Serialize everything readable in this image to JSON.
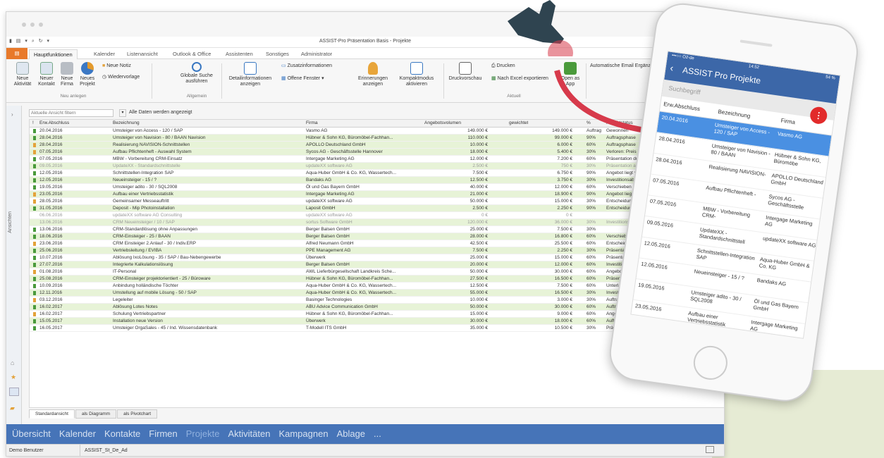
{
  "window": {
    "title": "ASSIST-Pro Präsentation Basis - Projekte"
  },
  "ribbon_tabs": [
    "Hauptfunktionen",
    "Kalender",
    "Listenansicht",
    "Outlook & Office",
    "Assistenten",
    "Sonstiges",
    "Administrator"
  ],
  "ribbon": {
    "neue_aktivitaet": "Neue Aktivität",
    "neuer_kontakt": "Neuer Kontakt",
    "neue_firma": "Neue Firma",
    "neues_projekt": "Neues Projekt",
    "neue_notiz": "Neue Notiz",
    "wiedervorlage": "Wiedervorlage",
    "group_neu": "Neu anlegen",
    "globale_suche": "Globale Suche ausführen",
    "group_allgemein": "Allgemein",
    "detailinfo": "Detailinformationen anzeigen",
    "zusatzinfo": "Zusatzinformationen",
    "offene_fenster": "Offene Fenster",
    "erinnerungen": "Erinnerungen anzeigen",
    "kompaktmodus": "Kompaktmodus aktivieren",
    "druckvorschau": "Druckvorschau",
    "drucken": "Drucken",
    "excel": "Nach Excel exportieren",
    "group_aktuell": "Aktuell",
    "open_app": "Open as App",
    "auto_email": "Automatische Email Ergänzung"
  },
  "left_sidebar_label": "Ansichten",
  "filter": {
    "placeholder": "Aktuelle Ansicht filtern",
    "status": "Alle Daten werden angezeigt"
  },
  "columns": [
    "!",
    "Erw.Abschluss",
    "Bezeichnung",
    "Firma",
    "Angebotsvolumen",
    "gewichtet",
    "%",
    "Projektstatus"
  ],
  "rows": [
    {
      "date": "20.04.2016",
      "bez": "Umsteiger von Access - 120 / SAP",
      "firma": "Vasmo AG",
      "vol": "149.000 €",
      "gew": "149.000 €",
      "pct": "Auftrag",
      "status": "Gewonnen",
      "flag": "#4a9a3b",
      "style": ""
    },
    {
      "date": "28.04.2016",
      "bez": "Umsteiger von Navision - 80 / BAAN Navision",
      "firma": "Hübner & Sohn KG, Büromöbel-Fachhan...",
      "vol": "110.000 €",
      "gew": "99.000 €",
      "pct": "90%",
      "status": "Auftragsphase",
      "flag": "#4a9a3b",
      "style": "g"
    },
    {
      "date": "28.04.2016",
      "bez": "Realisierung NAVISION-Schnittstellen",
      "firma": "APOLLO Deutschland GmbH",
      "vol": "10.000 €",
      "gew": "6.000 €",
      "pct": "60%",
      "status": "Auftragsphase",
      "flag": "#e3a23a",
      "style": "g"
    },
    {
      "date": "07.05.2016",
      "bez": "Aufbau Pflichtenheft - Auswahl System",
      "firma": "Sycos AG - Geschäftsstelle Hannover",
      "vol": "18.000 €",
      "gew": "5.400 €",
      "pct": "30%",
      "status": "Verloren: Preis",
      "flag": "#e3a23a",
      "style": "g"
    },
    {
      "date": "07.05.2016",
      "bez": "MBW - Vorbereitung CRM-Einsatz",
      "firma": "Intergage Marketing AG",
      "vol": "12.000 €",
      "gew": "7.200 €",
      "pct": "60%",
      "status": "Präsentation durchgefü...",
      "flag": "#4a9a3b",
      "style": ""
    },
    {
      "date": "09.05.2016",
      "bez": "UpdateXX - Standardschnittstelle",
      "firma": "updateXX software AG",
      "vol": "2.500 €",
      "gew": "750 €",
      "pct": "30%",
      "status": "Präsentation angefragt",
      "flag": "#4a9a3b",
      "style": "g gr"
    },
    {
      "date": "12.05.2016",
      "bez": "Schnittstellen-Integration SAP",
      "firma": "Aqua-Huber GmbH & Co. KG, Wassertech...",
      "vol": "7.500 €",
      "gew": "6.750 €",
      "pct": "90%",
      "status": "Angebot liegt vor",
      "flag": "#4a9a3b",
      "style": ""
    },
    {
      "date": "12.05.2016",
      "bez": "Neueinsteiger - 15 / ?",
      "firma": "Bandaks AG",
      "vol": "12.500 €",
      "gew": "3.750 €",
      "pct": "30%",
      "status": "Investitionsabsicht verifiz...",
      "flag": "#4a9a3b",
      "style": "g"
    },
    {
      "date": "19.05.2016",
      "bez": "Umsteiger adito - 30 / SQL2008",
      "firma": "Öl und Gas Bayern GmbH",
      "vol": "40.000 €",
      "gew": "12.000 €",
      "pct": "60%",
      "status": "Verschieben",
      "flag": "#4a9a3b",
      "style": ""
    },
    {
      "date": "23.05.2016",
      "bez": "Aufbau einer Vertriebsstatistik",
      "firma": "Intergage Marketing AG",
      "vol": "21.000 €",
      "gew": "18.900 €",
      "pct": "90%",
      "status": "Angebot liegt vor",
      "flag": "#e3a23a",
      "style": "g"
    },
    {
      "date": "28.05.2016",
      "bez": "Gemeinsamer Messeauftritt",
      "firma": "updateXX software AG",
      "vol": "50.000 €",
      "gew": "15.000 €",
      "pct": "30%",
      "status": "Entscheidungsphase",
      "flag": "#e3a23a",
      "style": ""
    },
    {
      "date": "31.05.2016",
      "bez": "Deposit - Mip Photoinstallation",
      "firma": "Laposit GmbH",
      "vol": "2.500 €",
      "gew": "2.250 €",
      "pct": "90%",
      "status": "Entscheidungsphase",
      "flag": "#4a9a3b",
      "style": "g"
    },
    {
      "date": "06.06.2016",
      "bez": "updateXX software AG Consulting",
      "firma": "updateXX software AG",
      "vol": "0 €",
      "gew": "0 €",
      "pct": "",
      "status": "",
      "flag": "",
      "style": "gr"
    },
    {
      "date": "13.06.2016",
      "bez": "CRM Neueinsteiger / 10 / SAP",
      "firma": "sortus Software GmbH",
      "vol": "120.000 €",
      "gew": "36.000 €",
      "pct": "30%",
      "status": "Investitionsabsicht verifiz...",
      "flag": "",
      "style": "g gr"
    },
    {
      "date": "13.06.2016",
      "bez": "CRM-Standardlösung ohne Anpassungen",
      "firma": "Berger Balsen GmbH",
      "vol": "25.000 €",
      "gew": "7.500 €",
      "pct": "30%",
      "status": "",
      "flag": "#4a9a3b",
      "style": ""
    },
    {
      "date": "18.06.2016",
      "bez": "CRM-Einsteiger - 25 / BAAN",
      "firma": "Berger Balsen GmbH",
      "vol": "28.000 €",
      "gew": "16.800 €",
      "pct": "60%",
      "status": "Verschieben",
      "flag": "#4a9a3b",
      "style": "g"
    },
    {
      "date": "23.06.2016",
      "bez": "CRM Einsteiger 2.Anlauf - 30 / Indiv.ERP",
      "firma": "Alfred Neumann GmbH",
      "vol": "42.500 €",
      "gew": "25.500 €",
      "pct": "60%",
      "status": "Entscheidungsphase",
      "flag": "#e3a23a",
      "style": ""
    },
    {
      "date": "25.06.2016",
      "bez": "Vertriebsleitung / EVIBA",
      "firma": "PPE Management AG",
      "vol": "7.500 €",
      "gew": "2.250 €",
      "pct": "30%",
      "status": "Präsentation angefragt",
      "flag": "#4a9a3b",
      "style": "g"
    },
    {
      "date": "10.07.2016",
      "bez": "Ablösung IxoLösung - 35 / SAP / Bau-Nebengewerbe",
      "firma": "Überwerk",
      "vol": "25.000 €",
      "gew": "15.000 €",
      "pct": "60%",
      "status": "Präsentation durchgefü...",
      "flag": "#4a9a3b",
      "style": ""
    },
    {
      "date": "27.07.2016",
      "bez": "Integrierte Kalkulationslösung",
      "firma": "Berger Balsen GmbH",
      "vol": "20.000 €",
      "gew": "12.000 €",
      "pct": "60%",
      "status": "Investitionsabsicht verifiz...",
      "flag": "#4a9a3b",
      "style": "g"
    },
    {
      "date": "01.08.2016",
      "bez": "IT-Personal",
      "firma": "AWL Lieferbürgesellschaft Landkreis Sche...",
      "vol": "50.000 €",
      "gew": "30.000 €",
      "pct": "60%",
      "status": "Angebot liegt vor",
      "flag": "#e3a23a",
      "style": ""
    },
    {
      "date": "25.08.2016",
      "bez": "CRM-Einsteiger projektorientiert - 25 / Büroware",
      "firma": "Hübner & Sohn KG, Büromöbel-Fachhan...",
      "vol": "27.500 €",
      "gew": "16.500 €",
      "pct": "60%",
      "status": "Präsentation durchgefü...",
      "flag": "#4a9a3b",
      "style": "g"
    },
    {
      "date": "10.09.2016",
      "bez": "Anbindung holländische Töchter",
      "firma": "Aqua-Huber GmbH & Co. KG, Wassertech...",
      "vol": "12.500 €",
      "gew": "7.500 €",
      "pct": "60%",
      "status": "Unterlagen versendet",
      "flag": "#4a9a3b",
      "style": ""
    },
    {
      "date": "12.11.2016",
      "bez": "Umstellung auf mobile Lösung - 50 / SAP",
      "firma": "Aqua-Huber GmbH & Co. KG, Wassertech...",
      "vol": "55.000 €",
      "gew": "16.500 €",
      "pct": "30%",
      "status": "Investitionsabsicht verifiz...",
      "flag": "#4a9a3b",
      "style": "g"
    },
    {
      "date": "03.12.2016",
      "bez": "Legeleiter",
      "firma": "Basinger Technologies",
      "vol": "10.000 €",
      "gew": "3.000 €",
      "pct": "30%",
      "status": "Auftragsphase",
      "flag": "#e3a23a",
      "style": ""
    },
    {
      "date": "16.02.2017",
      "bez": "Ablösung Lotes Notes",
      "firma": "ABU Advice Communication GmbH",
      "vol": "50.000 €",
      "gew": "30.000 €",
      "pct": "60%",
      "status": "Auftragsphase",
      "flag": "#4a9a3b",
      "style": "g"
    },
    {
      "date": "16.02.2017",
      "bez": "Schulung Vertriebspartner",
      "firma": "Hübner & Sohn KG, Büromöbel-Fachhan...",
      "vol": "15.000 €",
      "gew": "9.000 €",
      "pct": "60%",
      "status": "Angebot liegt vor",
      "flag": "#e3a23a",
      "style": ""
    },
    {
      "date": "15.05.2017",
      "bez": "Installation neue Version",
      "firma": "Überwerk",
      "vol": "30.000 €",
      "gew": "18.000 €",
      "pct": "60%",
      "status": "Auftragsphase",
      "flag": "#4a9a3b",
      "style": "g"
    },
    {
      "date": "16.05.2017",
      "bez": "Umsteiger OrgaSales - 45 / Ind. Wissensdatenbank",
      "firma": "T-Modell ITS GmbH",
      "vol": "35.000 €",
      "gew": "10.500 €",
      "pct": "30%",
      "status": "Präsentation angefragt",
      "flag": "#4a9a3b",
      "style": ""
    }
  ],
  "view_tabs": [
    "Standardansicht",
    "als Diagramm",
    "als Pivotchart"
  ],
  "navbar": [
    "Übersicht",
    "Kalender",
    "Kontakte",
    "Firmen",
    "Projekte",
    "Aktivitäten",
    "Kampagnen",
    "Ablage",
    "..."
  ],
  "navbar_selected": "Projekte",
  "status_bar": {
    "user": "Demo Benutzer",
    "db": "ASSIST_St_De_Ad"
  },
  "phone": {
    "statusbar_left": "•••○○ O2-de",
    "statusbar_time": "14:52",
    "statusbar_right": "54 %",
    "title": "ASSIST Pro Projekte",
    "search_placeholder": "Suchbegriff",
    "fab": "⋮",
    "cols": [
      "Erw.Abschluss",
      "Bezeichnung",
      "Firma"
    ],
    "rows": [
      {
        "date": "20.04.2016",
        "bez": "Umsteiger von Access - 120 / SAP",
        "firma": "Vasmo AG",
        "sel": true
      },
      {
        "date": "28.04.2016",
        "bez": "Umsteiger von Navision - 80 / BAAN",
        "firma": "Hübner & Sohn KG, Büromöbe"
      },
      {
        "date": "28.04.2016",
        "bez": "Realisierung NAVISION-",
        "firma": "APOLLO Deutschland GmbH"
      },
      {
        "date": "07.05.2016",
        "bez": "Aufbau Pflichtenheft -",
        "firma": "Sycos AG - Geschäftsstelle"
      },
      {
        "date": "07.05.2016",
        "bez": "MBW - Vorbereitung CRM-",
        "firma": "Intergage Marketing AG"
      },
      {
        "date": "09.05.2016",
        "bez": "UpdateXX - Standardschnittstell",
        "firma": "updateXX software AG"
      },
      {
        "date": "12.05.2016",
        "bez": "Schnittstellen-Integration SAP",
        "firma": "Aqua-Huber GmbH & Co. KG"
      },
      {
        "date": "12.05.2016",
        "bez": "Neueinsteiger - 15 / ?",
        "firma": "Bandaks AG"
      },
      {
        "date": "19.05.2016",
        "bez": "Umsteiger adito - 30 / SQL2008",
        "firma": "Öl und Gas Bayern GmbH"
      },
      {
        "date": "23.05.2016",
        "bez": "Aufbau einer Vertriebsstatistik",
        "firma": "Intergage Marketing AG"
      },
      {
        "date": "28.05.2016",
        "bez": "Gemeinsamer Messeauftritt",
        "firma": "updateXX software AG"
      },
      {
        "date": "31.05.2016",
        "bez": "Deposit - Mip Photoinstallation",
        "firma": "Laposit GmbH"
      }
    ]
  },
  "colors": {
    "ribbon_file": "#e8792a",
    "navbar": "#4674b8",
    "phone_header": "#3c67a8",
    "phone_selected": "#4a90e2",
    "fab": "#e22b2b",
    "arrow": "#d73a4b",
    "hand": "#2f4450",
    "row_green": "#e7f3d7"
  }
}
